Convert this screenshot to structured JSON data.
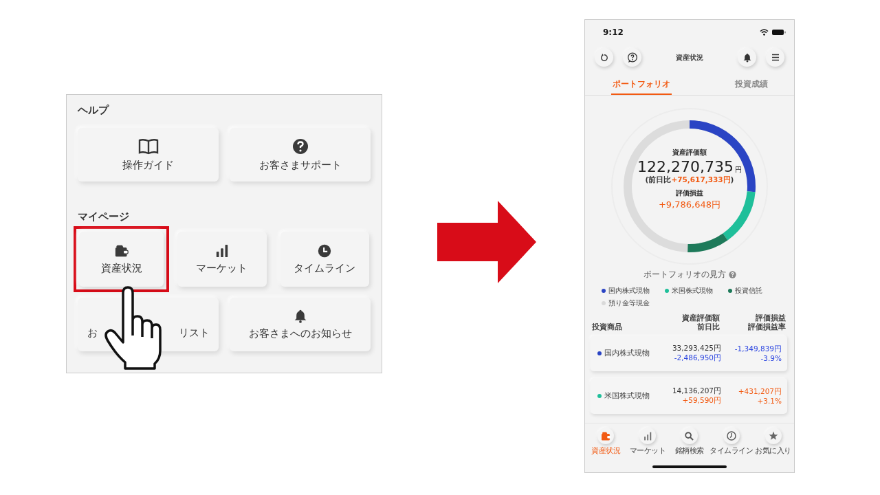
{
  "menu_panel": {
    "help_section": {
      "title": "ヘルプ",
      "items": [
        {
          "label": "操作ガイド"
        },
        {
          "label": "お客さまサポート"
        }
      ]
    },
    "mypage_section": {
      "title": "マイページ",
      "items": [
        {
          "label": "資産状況",
          "highlighted": true
        },
        {
          "label": "マーケット",
          "highlighted": false
        },
        {
          "label": "タイムライン",
          "highlighted": false
        }
      ],
      "items_row2": [
        {
          "label_parts": [
            "お",
            "リスト"
          ]
        },
        {
          "label": "お客さまへのお知らせ"
        }
      ]
    }
  },
  "phone": {
    "status_bar": {
      "time": "9:12"
    },
    "header": {
      "title": "資産状況"
    },
    "tabs": [
      {
        "label": "ポートフォリオ",
        "selected": true
      },
      {
        "label": "投資成績",
        "selected": false
      }
    ],
    "summary": {
      "total_label": "資産評価額",
      "total_value": "122,270,735",
      "total_unit": "円",
      "day_change": {
        "prefix": "(前日比",
        "value": "+75,617,333円",
        "suffix": ")"
      },
      "pl_label": "評価損益",
      "pl_value": "+9,786,648円"
    },
    "portfolio_help": "ポートフォリオの見方",
    "legend": [
      {
        "label": "国内株式現物",
        "color": "#2a44c4"
      },
      {
        "label": "米国株式現物",
        "color": "#1fbf9a"
      },
      {
        "label": "投資信託",
        "color": "#1e7a5a"
      },
      {
        "label": "預り金等現金",
        "color": "#d9d9d9"
      }
    ],
    "table": {
      "columns": [
        {
          "lines": [
            "投資商品"
          ]
        },
        {
          "lines": [
            "資産評価額",
            "前日比"
          ]
        },
        {
          "lines": [
            "評価損益",
            "評価損益率"
          ]
        }
      ],
      "rows": [
        {
          "name": "国内株式現物",
          "color": "#2a44c4",
          "value": "33,293,425円",
          "day_change": "-2,486,950円",
          "day_negative": true,
          "pl": "-1,349,839円",
          "pl_rate": "-3.9%",
          "pl_negative": true
        },
        {
          "name": "米国株式現物",
          "color": "#1fbf9a",
          "value": "14,136,207円",
          "day_change": "+59,590円",
          "day_negative": false,
          "pl": "+431,207円",
          "pl_rate": "+3.1%",
          "pl_negative": false
        }
      ]
    },
    "bottom_nav": [
      {
        "label": "資産状況",
        "selected": true
      },
      {
        "label": "マーケット",
        "selected": false
      },
      {
        "label": "銘柄検索",
        "selected": false
      },
      {
        "label": "タイムライン",
        "selected": false
      },
      {
        "label": "お気に入り",
        "selected": false
      }
    ]
  }
}
